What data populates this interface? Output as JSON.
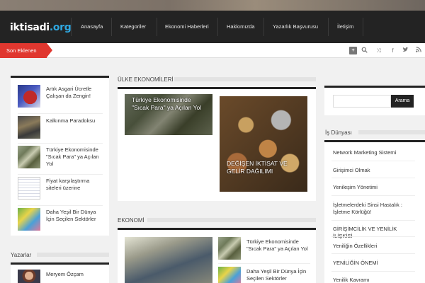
{
  "header": {
    "logo_main": "iktisadi",
    "logo_tld": ".org",
    "nav": [
      "Anasayfa",
      "Kategoriler",
      "Ekonomi Haberleri",
      "Hakkımızda",
      "Yazarlık Başvurusu",
      "İletişim"
    ]
  },
  "ticker": {
    "label": "Son Eklenen"
  },
  "toolbar_icons": [
    "plus-icon",
    "search-icon",
    "shuffle-icon",
    "facebook-icon",
    "twitter-icon",
    "rss-icon"
  ],
  "sidebar_left": {
    "items": [
      {
        "title": "Artık Asgari Ücretle Çalışan da Zengin!",
        "thumb": "pie-chart"
      },
      {
        "title": "Kalkınma Paradoksu",
        "thumb": "workers"
      },
      {
        "title": "Türkiye Ekonomisinde \"Sıcak Para\" ya Açılan Yol",
        "thumb": "dollars"
      },
      {
        "title": "Fiyat karşılaştırma siteleri üzerine",
        "thumb": "table"
      },
      {
        "title": "Daha Yeşil Bir Dünya İçin Seçilen Sektörler",
        "thumb": "green-world"
      }
    ],
    "authors_label": "Yazarlar",
    "author_name": "Meryem Özçam"
  },
  "main": {
    "section1_label": "ÜLKE EKONOMİLERİ",
    "feature_left_title": "Türkiye Ekonomisinde \"Sıcak Para\" ya Açılan Yol",
    "feature_right_title": "DEĞİŞEN İKTİSAT VE GELİR DAĞILIMI",
    "section2_label": "EKONOMİ",
    "eco_items": [
      {
        "title": "Türkiye Ekonomisinde \"Sıcak Para\" ya Açılan Yol"
      },
      {
        "title": "Daha Yeşil Bir Dünya İçin Seçilen Sektörler"
      }
    ]
  },
  "sidebar_right": {
    "search_button": "Arama",
    "search_placeholder": "",
    "section_label": "İş Dünyası",
    "links": [
      "Network Marketing Sistemi",
      "Girişimci Olmak",
      "Yenileşim Yönetimi",
      "İşletmelerdeki Sinsi Hastalık : İşletme Körlüğü!",
      "GİRİŞİMCİLİK VE YENİLİK İLİŞKİSİ",
      "Yeniliğin Özellikleri",
      "YENİLİĞİN ÖNEMİ",
      "Yenilik Kavramı"
    ]
  },
  "colors": {
    "accent_red": "#e0372f",
    "logo_blue": "#2fa7e0",
    "dark": "#232323"
  }
}
